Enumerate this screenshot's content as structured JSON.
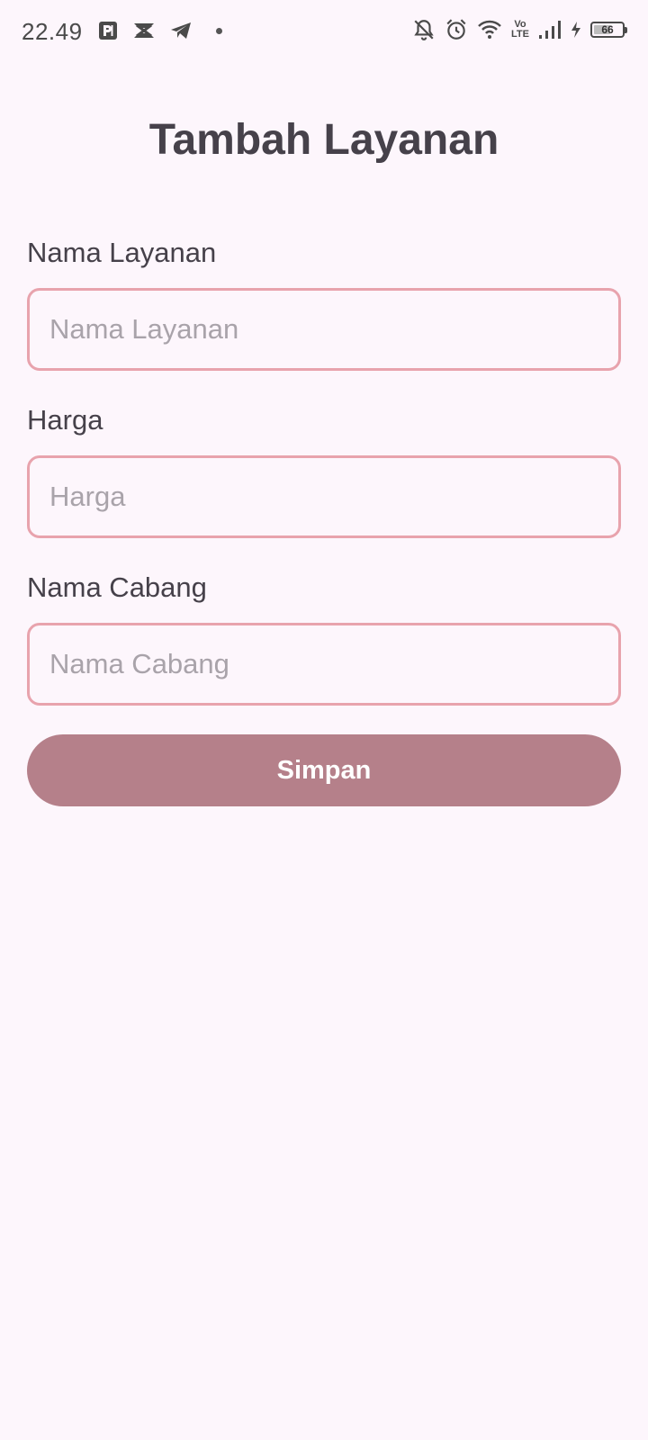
{
  "status_bar": {
    "time": "22.49",
    "volte_top": "Vo",
    "volte_bottom": "LTE",
    "battery_level": "66",
    "battery_fraction": 0.66,
    "left_icons": [
      "parking-app-icon",
      "capcut-icon",
      "telegram-icon",
      "notification-dot-icon"
    ],
    "right_icons": [
      "bell-off-icon",
      "alarm-icon",
      "wifi-icon",
      "volte-icon",
      "signal-icon",
      "charging-icon",
      "battery-icon"
    ]
  },
  "page": {
    "title": "Tambah Layanan"
  },
  "form": {
    "fields": [
      {
        "label": "Nama Layanan",
        "placeholder": "Nama Layanan",
        "value": ""
      },
      {
        "label": "Harga",
        "placeholder": "Harga",
        "value": ""
      },
      {
        "label": "Nama Cabang",
        "placeholder": "Nama Cabang",
        "value": ""
      }
    ],
    "submit_label": "Simpan"
  },
  "colors": {
    "background": "#fdf6fc",
    "input_border": "#e8a3ad",
    "button": "#b5808a",
    "button_text": "#ffffff",
    "text": "#46414a",
    "placeholder": "#a9a3aa"
  }
}
